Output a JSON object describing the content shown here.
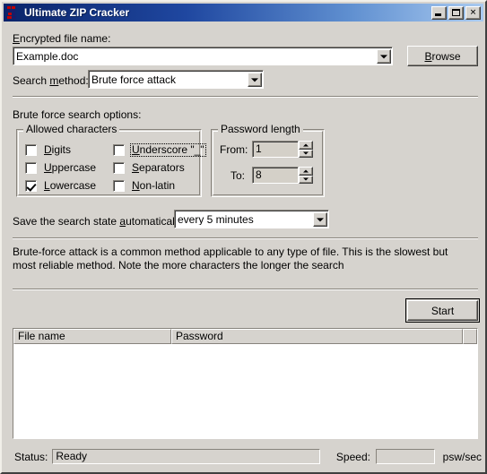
{
  "window": {
    "title": "Ultimate ZIP Cracker",
    "icon": "zip-app-icon",
    "controls": {
      "minimize": "minimize-icon",
      "maximize": "maximize-icon",
      "close": "✕"
    }
  },
  "file_section": {
    "label_prefix": "E",
    "label_rest": "ncrypted file name:",
    "label_full": "Encrypted file name:",
    "value": "Example.doc",
    "browse_prefix": "B",
    "browse_rest": "rowse",
    "browse_label": "Browse"
  },
  "search_method": {
    "label_a": "Search ",
    "label_u": "m",
    "label_b": "ethod:",
    "label_full": "Search method:",
    "value": "Brute force attack"
  },
  "options": {
    "section_label": "Brute force search options:",
    "allowed_characters": {
      "title": "Allowed characters",
      "items": [
        {
          "key": "digits",
          "pre": "D",
          "rest": "igits",
          "label": "Digits",
          "checked": false,
          "focused": false
        },
        {
          "key": "uppercase",
          "pre": "U",
          "rest": "ppercase",
          "label": "Uppercase",
          "checked": false,
          "focused": false
        },
        {
          "key": "lowercase",
          "pre": "L",
          "rest": "owercase",
          "label": "Lowercase",
          "checked": true,
          "focused": false
        },
        {
          "key": "underscore",
          "pre": "U",
          "rest": "nderscore \"_\"",
          "label": "Underscore \"_\"",
          "checked": false,
          "focused": true
        },
        {
          "key": "separators",
          "pre": "S",
          "rest": "eparators",
          "label": "Separators",
          "checked": false,
          "focused": false
        },
        {
          "key": "nonlatin",
          "pre": "N",
          "rest": "on-latin",
          "label": "Non-latin",
          "checked": false,
          "focused": false
        }
      ]
    },
    "password_length": {
      "title": "Password length",
      "from_label": "From:",
      "from_value": "1",
      "to_label": "To:",
      "to_value": "8"
    }
  },
  "autosave": {
    "label_a": "Save the search state ",
    "label_u": "a",
    "label_b": "utomatically:",
    "label_full": "Save the search state automatically:",
    "value": "every 5 minutes"
  },
  "description": {
    "text": "Brute-force attack is a common method applicable to any type of file. This is the slowest but most reliable method. Note the more characters the longer the search"
  },
  "actions": {
    "start_label": "Start"
  },
  "results": {
    "columns": [
      "File name",
      "Password",
      ""
    ],
    "rows": []
  },
  "statusbar": {
    "status_label": "Status:",
    "status_value": "Ready",
    "speed_label": "Speed:",
    "speed_value": "",
    "speed_units": "psw/sec"
  },
  "colors": {
    "face": "#d6d3ce",
    "title_start": "#0a246a",
    "title_end": "#a9caf0",
    "shadow": "#87837c",
    "field": "#ffffff"
  }
}
